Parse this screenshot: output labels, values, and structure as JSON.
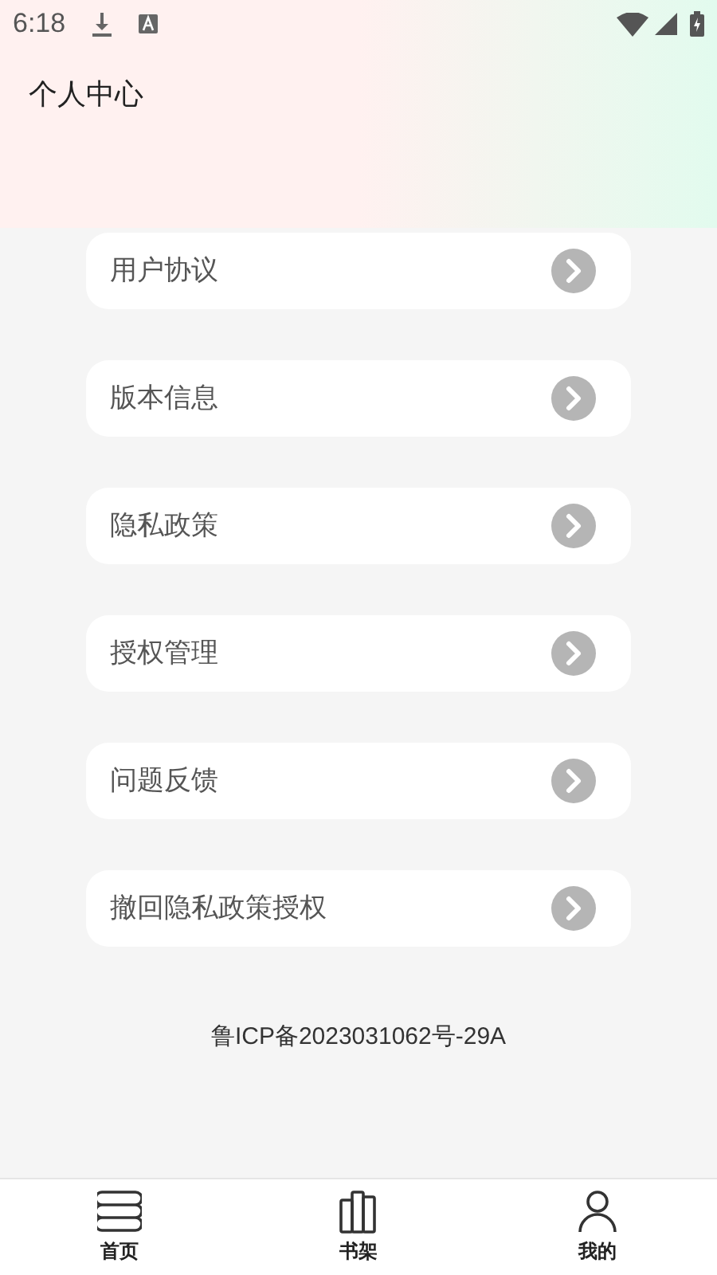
{
  "status_bar": {
    "time": "6:18"
  },
  "header": {
    "title": "个人中心"
  },
  "menu": [
    {
      "label": "用户协议"
    },
    {
      "label": "版本信息"
    },
    {
      "label": "隐私政策"
    },
    {
      "label": "授权管理"
    },
    {
      "label": "问题反馈"
    },
    {
      "label": "撤回隐私政策授权"
    }
  ],
  "footer": {
    "icp": "鲁ICP备2023031062号-29A"
  },
  "tabs": [
    {
      "label": "首页",
      "kind": "home"
    },
    {
      "label": "书架",
      "kind": "shelf"
    },
    {
      "label": "我的",
      "kind": "me"
    }
  ]
}
